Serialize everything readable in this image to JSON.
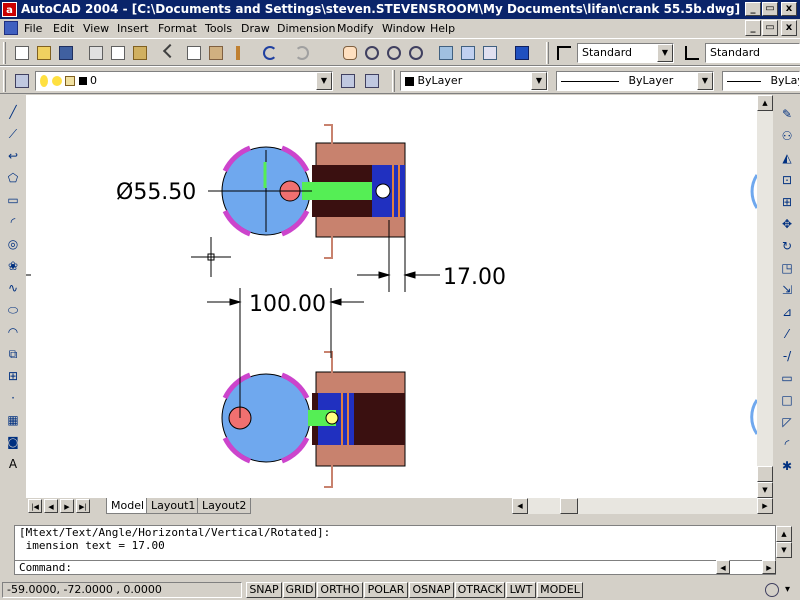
{
  "window": {
    "title": "AutoCAD 2004 - [C:\\Documents and Settings\\steven.STEVENSROOM\\My Documents\\lifan\\crank 55.5b.dwg]",
    "logo": "a",
    "minimize": "_",
    "restore": "▭",
    "close": "x"
  },
  "menu": {
    "items": [
      "File",
      "Edit",
      "View",
      "Insert",
      "Format",
      "Tools",
      "Draw",
      "Dimension",
      "Modify",
      "Window",
      "Help"
    ],
    "doc_min": "_",
    "doc_restore": "▭",
    "doc_close": "x"
  },
  "standard_toolbar": {
    "text_style": "Standard",
    "dim_style": "Standard"
  },
  "layers_toolbar": {
    "layer_name": "0",
    "color": "ByLayer",
    "linetype": "ByLayer",
    "lineweight": "ByLayer"
  },
  "drawing": {
    "dim_diameter": "Ø55.50",
    "dim_width": "17.00",
    "dim_distance": "100.00",
    "colors": {
      "disc": "#6fa8ee",
      "pin": "#f07070",
      "arc": "#cc44cc",
      "housing": "#c8826e",
      "shaft": "#55ee55",
      "bearing": "#2030c0",
      "dark": "#3a1010"
    }
  },
  "tabs": {
    "items": [
      "Model",
      "Layout1",
      "Layout2"
    ],
    "active": "Model"
  },
  "command": {
    "history": [
      "[Mtext/Text/Angle/Horizontal/Vertical/Rotated]:",
      " imension text = 17.00"
    ],
    "prompt": "Command:"
  },
  "status": {
    "coords": "-59.0000, -72.0000 , 0.0000",
    "toggles": [
      "SNAP",
      "GRID",
      "ORTHO",
      "POLAR",
      "OSNAP",
      "OTRACK",
      "LWT",
      "MODEL"
    ]
  }
}
